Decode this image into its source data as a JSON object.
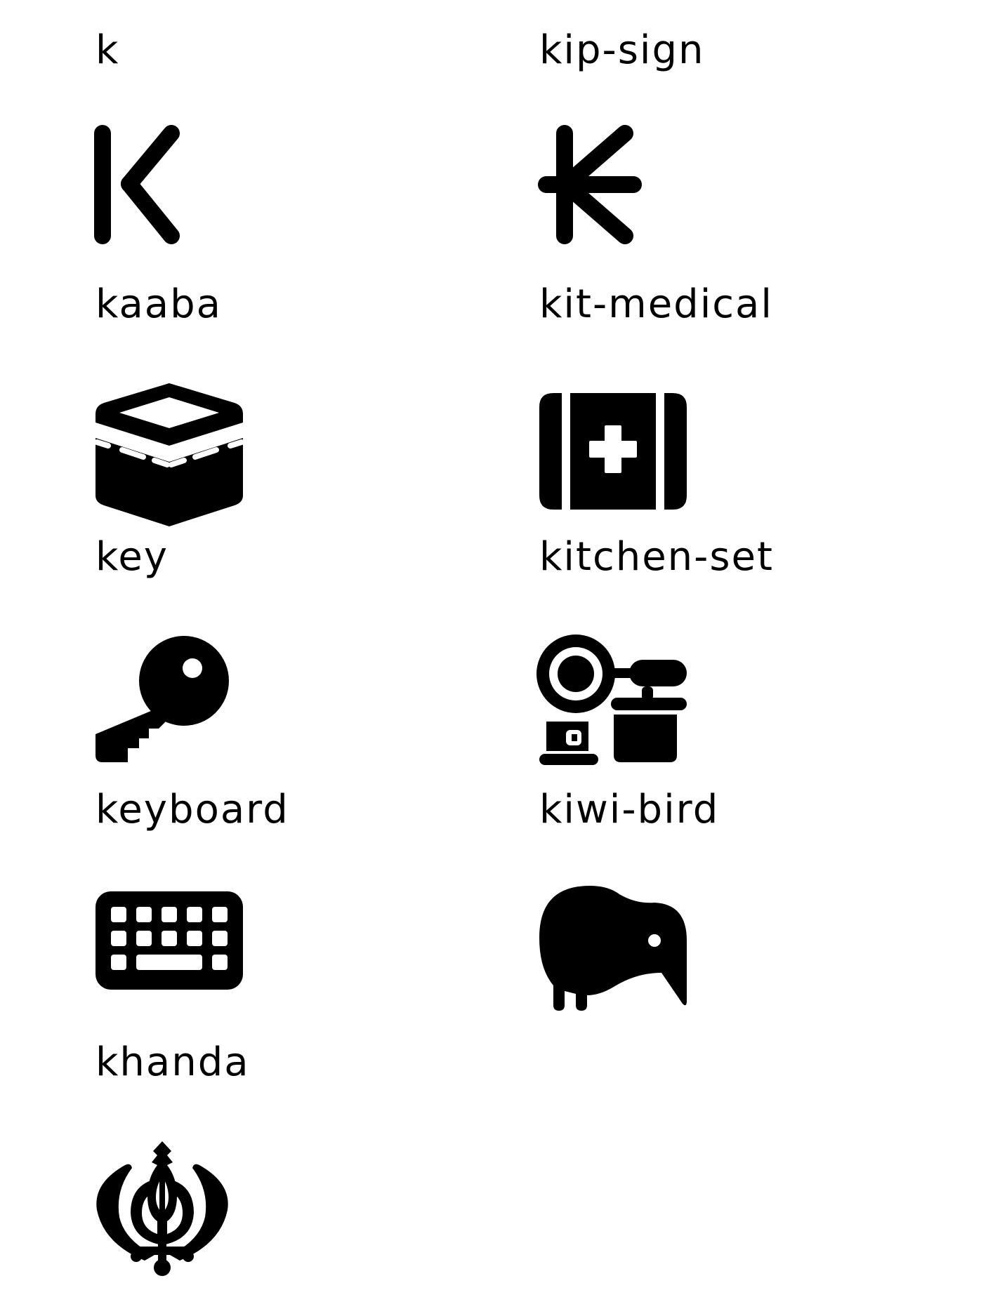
{
  "icons": [
    {
      "label": "k",
      "icon": "k-icon"
    },
    {
      "label": "kip-sign",
      "icon": "kip-sign-icon"
    },
    {
      "label": "kaaba",
      "icon": "kaaba-icon"
    },
    {
      "label": "kit-medical",
      "icon": "kit-medical-icon"
    },
    {
      "label": "key",
      "icon": "key-icon"
    },
    {
      "label": "kitchen-set",
      "icon": "kitchen-set-icon"
    },
    {
      "label": "keyboard",
      "icon": "keyboard-icon"
    },
    {
      "label": "kiwi-bird",
      "icon": "kiwi-bird-icon"
    },
    {
      "label": "khanda",
      "icon": "khanda-icon"
    }
  ],
  "colors": {
    "foreground": "#000000",
    "background": "#ffffff"
  }
}
